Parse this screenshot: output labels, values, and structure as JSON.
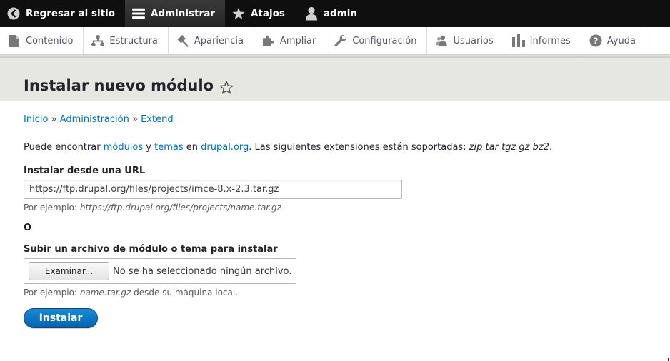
{
  "toolbar": {
    "back_label": "Regresar al sitio",
    "manage_label": "Administrar",
    "shortcuts_label": "Atajos",
    "user_label": "admin"
  },
  "tray": {
    "items": [
      {
        "label": "Contenido",
        "icon": "file-icon"
      },
      {
        "label": "Estructura",
        "icon": "hierarchy-icon"
      },
      {
        "label": "Apariencia",
        "icon": "paint-icon"
      },
      {
        "label": "Ampliar",
        "icon": "puzzle-icon"
      },
      {
        "label": "Configuración",
        "icon": "wrench-icon"
      },
      {
        "label": "Usuarios",
        "icon": "users-icon"
      },
      {
        "label": "Informes",
        "icon": "bar-chart-icon"
      },
      {
        "label": "Ayuda",
        "icon": "question-icon"
      }
    ]
  },
  "page": {
    "title": "Instalar nuevo módulo"
  },
  "breadcrumb": {
    "items": [
      "Inicio",
      "Administración",
      "Extend"
    ],
    "separator": "»"
  },
  "help": {
    "prefix": "Puede encontrar ",
    "link_modules": "módulos",
    "and": " y ",
    "link_themes": "temas",
    "in": " en ",
    "link_drupal": "drupal.org",
    "suffix": ". Las siguientes extensiones están soportadas: ",
    "extensions": "zip tar tgz gz bz2",
    "end": "."
  },
  "form": {
    "url_label": "Instalar desde una URL",
    "url_value": "https://ftp.drupal.org/files/projects/imce-8.x-2.3.tar.gz",
    "url_desc_prefix": "Por ejemplo: ",
    "url_desc_example": "https://ftp.drupal.org/files/projects/name.tar.gz",
    "or_label": "O",
    "upload_label": "Subir un archivo de módulo o tema para instalar",
    "browse_label": "Examinar...",
    "no_file_label": "No se ha seleccionado ningún archivo.",
    "upload_desc_prefix": "Por ejemplo: ",
    "upload_desc_example": "name.tar.gz",
    "upload_desc_suffix": " desde su máquina local.",
    "submit_label": "Instalar"
  },
  "colors": {
    "link": "#0071b8",
    "toolbar_bg": "#0f0f0f",
    "header_bg": "#e6e6e3",
    "primary_button": "#0071b8"
  }
}
